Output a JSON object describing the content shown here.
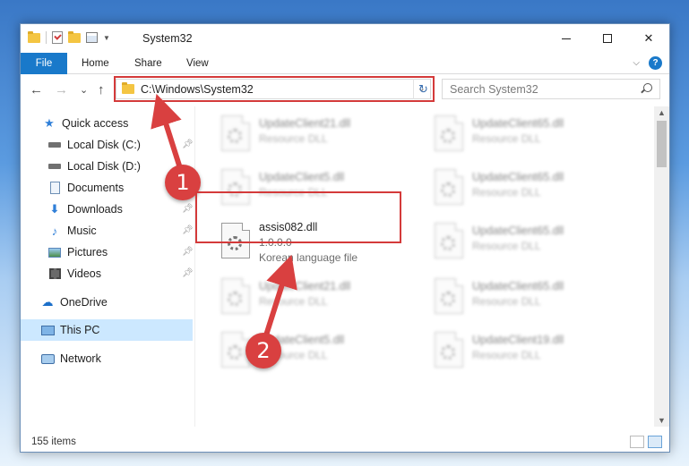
{
  "window": {
    "title": "System32",
    "controls": {
      "minimize": "",
      "maximize": "",
      "close": "✕"
    }
  },
  "ribbon": {
    "tabs": [
      "File",
      "Home",
      "Share",
      "View"
    ],
    "help": "?"
  },
  "nav": {
    "back": "←",
    "forward": "→",
    "recent": "⌄",
    "up": "↑",
    "address": "C:\\Windows\\System32",
    "address_dropdown": "⌄",
    "refresh": "↻",
    "search_placeholder": "Search System32"
  },
  "sidebar": {
    "items": [
      {
        "label": "Quick access",
        "icon": "star-icon",
        "pinned": false
      },
      {
        "label": "Local Disk (C:)",
        "icon": "drive-icon",
        "pinned": true
      },
      {
        "label": "Local Disk (D:)",
        "icon": "drive-icon",
        "pinned": false
      },
      {
        "label": "Documents",
        "icon": "documents-icon",
        "pinned": true
      },
      {
        "label": "Downloads",
        "icon": "download-icon",
        "pinned": true
      },
      {
        "label": "Music",
        "icon": "music-icon",
        "pinned": true
      },
      {
        "label": "Pictures",
        "icon": "pictures-icon",
        "pinned": true
      },
      {
        "label": "Videos",
        "icon": "videos-icon",
        "pinned": true
      },
      {
        "label": "OneDrive",
        "icon": "cloud-icon",
        "pinned": false
      },
      {
        "label": "This PC",
        "icon": "computer-icon",
        "pinned": false,
        "selected": true
      },
      {
        "label": "Network",
        "icon": "network-icon",
        "pinned": false
      }
    ]
  },
  "files": [
    {
      "name": "UpdateClient21.dll",
      "type": "Resource DLL",
      "blurred": true
    },
    {
      "name": "UpdateClient65.dll",
      "type": "Resource DLL",
      "blurred": true
    },
    {
      "name": "UpdateClient5.dll",
      "type": "Resource DLL",
      "blurred": true
    },
    {
      "name": "UpdateClient65.dll",
      "type": "Resource DLL",
      "blurred": true
    },
    {
      "name": "assis082.dll",
      "version": "1.0.0.0",
      "type": "Korean language file",
      "blurred": false,
      "highlighted": true
    },
    {
      "name": "UpdateClient65.dll",
      "type": "Resource DLL",
      "blurred": true
    },
    {
      "name": "UpdateClient21.dll",
      "type": "Resource DLL",
      "blurred": true
    },
    {
      "name": "UpdateClient65.dll",
      "type": "Resource DLL",
      "blurred": true
    },
    {
      "name": "UpdateClient5.dll",
      "type": "Resource DLL",
      "blurred": true
    },
    {
      "name": "UpdateClient19.dll",
      "type": "Resource DLL",
      "blurred": true
    }
  ],
  "status": {
    "item_count": "155 items"
  },
  "callouts": [
    {
      "label": "1"
    },
    {
      "label": "2"
    }
  ],
  "colors": {
    "accent": "#1979ca",
    "callout": "#d94040",
    "selection": "#cce8ff"
  }
}
